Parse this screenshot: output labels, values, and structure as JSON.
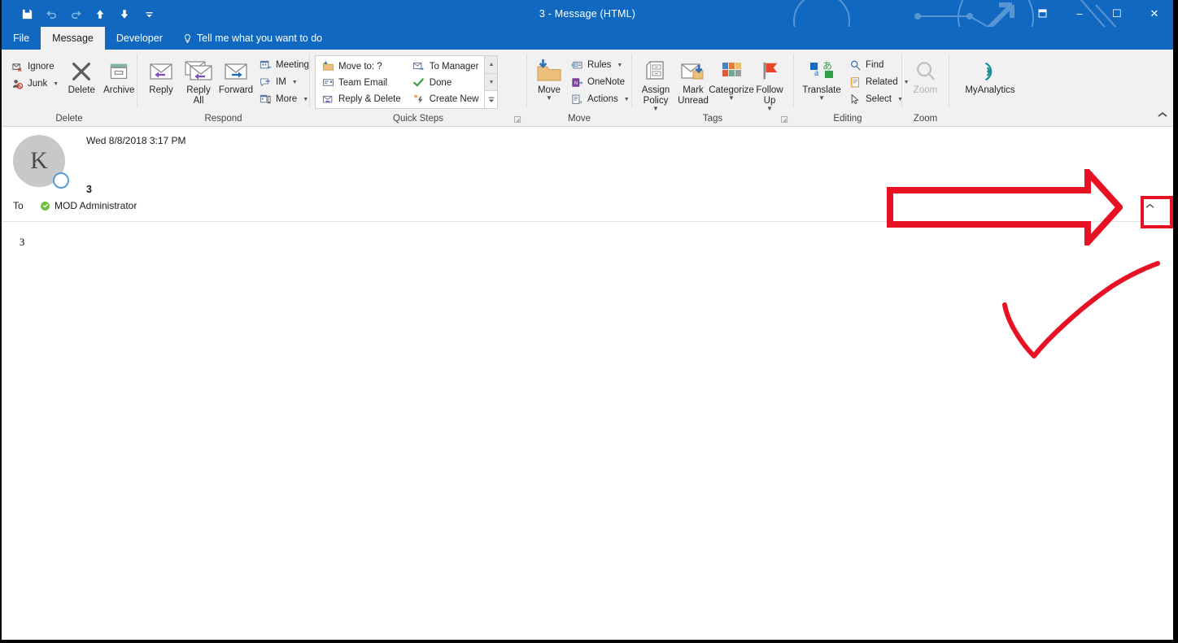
{
  "window": {
    "title": "3  -  Message (HTML)",
    "quick_access": [
      {
        "name": "save-icon",
        "glyph": "save"
      },
      {
        "name": "undo-icon",
        "glyph": "undo",
        "disabled": true
      },
      {
        "name": "redo-icon",
        "glyph": "redo",
        "disabled": true
      },
      {
        "name": "previous-item-icon",
        "glyph": "up"
      },
      {
        "name": "next-item-icon",
        "glyph": "down"
      },
      {
        "name": "customize-quick-access-toolbar-icon",
        "glyph": "more"
      }
    ],
    "controls": {
      "restore_up": "restore-up",
      "minimize": "–",
      "maximize": "☐",
      "close": "✕"
    }
  },
  "tabs": {
    "file": "File",
    "items": [
      {
        "label": "Message",
        "active": true
      },
      {
        "label": "Developer",
        "active": false
      }
    ],
    "tell_me": "Tell me what you want to do"
  },
  "ribbon": {
    "collapse_label": "^",
    "groups": [
      {
        "name": "delete",
        "label": "Delete",
        "small_buttons": [
          {
            "label": "Ignore",
            "icon": "ignore-icon",
            "caret": false
          },
          {
            "label": "Junk",
            "icon": "junk-icon",
            "caret": true
          }
        ],
        "big_buttons": [
          {
            "label": "Delete",
            "icon": "delete-icon"
          },
          {
            "label": "Archive",
            "icon": "archive-icon"
          }
        ]
      },
      {
        "name": "respond",
        "label": "Respond",
        "big_buttons": [
          {
            "label": "Reply",
            "icon": "reply-icon"
          },
          {
            "label": "Reply\nAll",
            "icon": "reply-all-icon"
          },
          {
            "label": "Forward",
            "icon": "forward-icon"
          }
        ],
        "small_buttons": [
          {
            "label": "Meeting",
            "icon": "meeting-icon",
            "caret": false
          },
          {
            "label": "IM",
            "icon": "im-icon",
            "caret": true
          },
          {
            "label": "More",
            "icon": "more-respond-icon",
            "caret": true
          }
        ]
      },
      {
        "name": "quick-steps",
        "label": "Quick Steps",
        "gallery": [
          {
            "label": "Move to: ?",
            "icon": "move-to-icon"
          },
          {
            "label": "Team Email",
            "icon": "team-email-icon"
          },
          {
            "label": "Reply & Delete",
            "icon": "reply-delete-icon"
          },
          {
            "label": "To Manager",
            "icon": "to-manager-icon"
          },
          {
            "label": "Done",
            "icon": "done-icon"
          },
          {
            "label": "Create New",
            "icon": "create-new-icon"
          }
        ],
        "has_dialog_launcher": true
      },
      {
        "name": "move",
        "label": "Move",
        "big_buttons": [
          {
            "label": "Move",
            "icon": "move-icon",
            "caret": true
          }
        ],
        "small_buttons": [
          {
            "label": "Rules",
            "icon": "rules-icon",
            "caret": true
          },
          {
            "label": "OneNote",
            "icon": "onenote-icon",
            "caret": false
          },
          {
            "label": "Actions",
            "icon": "actions-icon",
            "caret": true
          }
        ]
      },
      {
        "name": "tags",
        "label": "Tags",
        "big_buttons": [
          {
            "label": "Assign\nPolicy",
            "icon": "assign-policy-icon",
            "caret": true
          },
          {
            "label": "Mark\nUnread",
            "icon": "mark-unread-icon",
            "caret": false
          },
          {
            "label": "Categorize",
            "icon": "categorize-icon",
            "caret": true
          },
          {
            "label": "Follow\nUp",
            "icon": "follow-up-icon",
            "caret": true
          }
        ],
        "has_dialog_launcher": true
      },
      {
        "name": "editing",
        "label": "Editing",
        "big_buttons": [
          {
            "label": "Translate",
            "icon": "translate-icon",
            "caret": true
          }
        ],
        "small_buttons": [
          {
            "label": "Find",
            "icon": "find-icon",
            "caret": false
          },
          {
            "label": "Related",
            "icon": "related-icon",
            "caret": true
          },
          {
            "label": "Select",
            "icon": "select-icon",
            "caret": true
          }
        ]
      },
      {
        "name": "zoom",
        "label": "Zoom",
        "big_buttons": [
          {
            "label": "Zoom",
            "icon": "zoom-icon",
            "disabled": true
          }
        ]
      },
      {
        "name": "myanalytics",
        "label": "",
        "big_buttons": [
          {
            "label": "MyAnalytics",
            "icon": "myanalytics-icon"
          }
        ]
      }
    ]
  },
  "message": {
    "avatar_initial": "K",
    "sent_date": "Wed 8/8/2018 3:17 PM",
    "subject": "3",
    "to_label": "To",
    "recipient": "MOD Administrator",
    "body": "3",
    "expand_header_label": "^"
  },
  "annotations": [
    {
      "name": "red-arrow-annotation",
      "shape": "arrow-right",
      "color": "#e81123"
    },
    {
      "name": "red-box-annotation",
      "shape": "rectangle",
      "color": "#e81123"
    },
    {
      "name": "red-checkmark-annotation",
      "shape": "checkmark",
      "color": "#e81123"
    }
  ],
  "colors": {
    "title_bar": "#1068c0",
    "ribbon_bg": "#f1f1f1",
    "annotation_red": "#e81123",
    "presence_green": "#71bf44"
  }
}
